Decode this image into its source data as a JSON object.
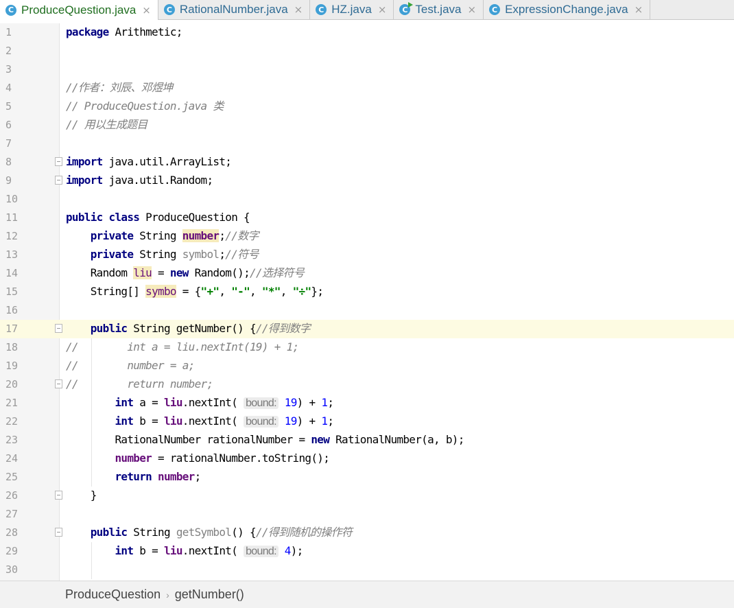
{
  "tabs": [
    {
      "label": "ProduceQuestion.java",
      "active": true,
      "icon": "class-icon"
    },
    {
      "label": "RationalNumber.java",
      "active": false,
      "icon": "class-icon"
    },
    {
      "label": "HZ.java",
      "active": false,
      "icon": "class-icon"
    },
    {
      "label": "Test.java",
      "active": false,
      "icon": "runnable-class-icon"
    },
    {
      "label": "ExpressionChange.java",
      "active": false,
      "icon": "class-icon"
    }
  ],
  "editor": {
    "current_line": 17,
    "lines": [
      {
        "n": "1",
        "segs": [
          [
            "k",
            "package"
          ],
          [
            "",
            "&nbsp;Arithmetic;"
          ]
        ]
      },
      {
        "n": "2",
        "segs": []
      },
      {
        "n": "3",
        "segs": []
      },
      {
        "n": "4",
        "segs": [
          [
            "c",
            "//作者：刘辰、邓煜坤"
          ]
        ]
      },
      {
        "n": "5",
        "segs": [
          [
            "c",
            "// ProduceQuestion.java 类"
          ]
        ]
      },
      {
        "n": "6",
        "segs": [
          [
            "c",
            "// 用以生成题目"
          ]
        ]
      },
      {
        "n": "7",
        "segs": []
      },
      {
        "n": "8",
        "fold": true,
        "segs": [
          [
            "k",
            "import"
          ],
          [
            "",
            "&nbsp;java.util.ArrayList;"
          ]
        ]
      },
      {
        "n": "9",
        "fold": true,
        "segs": [
          [
            "k",
            "import"
          ],
          [
            "",
            "&nbsp;java.util.Random;"
          ]
        ]
      },
      {
        "n": "10",
        "segs": []
      },
      {
        "n": "11",
        "segs": [
          [
            "k",
            "public class"
          ],
          [
            "",
            "&nbsp;ProduceQuestion {"
          ]
        ]
      },
      {
        "n": "12",
        "segs": [
          [
            "",
            "    "
          ],
          [
            "k",
            "private"
          ],
          [
            "",
            "&nbsp;String "
          ],
          [
            "fhl",
            "number"
          ],
          [
            "",
            ";"
          ],
          [
            "c",
            "//数字"
          ]
        ]
      },
      {
        "n": "13",
        "segs": [
          [
            "",
            "    "
          ],
          [
            "k",
            "private"
          ],
          [
            "",
            "&nbsp;String "
          ],
          [
            "u",
            "symbol"
          ],
          [
            "",
            ";"
          ],
          [
            "c",
            "//符号"
          ]
        ]
      },
      {
        "n": "14",
        "segs": [
          [
            "",
            "    Random "
          ],
          [
            "fh",
            "liu"
          ],
          [
            "",
            "&nbsp;= "
          ],
          [
            "k",
            "new"
          ],
          [
            "",
            "&nbsp;Random();"
          ],
          [
            "c",
            "//选择符号"
          ]
        ]
      },
      {
        "n": "15",
        "segs": [
          [
            "",
            "    String[] "
          ],
          [
            "fh",
            "symbo"
          ],
          [
            "",
            "&nbsp;= {"
          ],
          [
            "s",
            "\"+\""
          ],
          [
            "",
            ", "
          ],
          [
            "s",
            "\"-\""
          ],
          [
            "",
            ", "
          ],
          [
            "s",
            "\"*\""
          ],
          [
            "",
            ", "
          ],
          [
            "s",
            "\"÷\""
          ],
          [
            "",
            "};"
          ]
        ]
      },
      {
        "n": "16",
        "segs": []
      },
      {
        "n": "17",
        "fold": true,
        "segs": [
          [
            "",
            "    "
          ],
          [
            "k",
            "public"
          ],
          [
            "",
            "&nbsp;String getNumber() {"
          ],
          [
            "c",
            "//得到数字"
          ]
        ]
      },
      {
        "n": "18",
        "segs": [
          [
            "c",
            "//        int a = liu.nextInt(19) + 1;"
          ]
        ]
      },
      {
        "n": "19",
        "segs": [
          [
            "c",
            "//        number = a;"
          ]
        ]
      },
      {
        "n": "20",
        "fold": true,
        "segs": [
          [
            "c",
            "//        return number;"
          ]
        ]
      },
      {
        "n": "21",
        "segs": [
          [
            "",
            "        "
          ],
          [
            "k",
            "int"
          ],
          [
            "",
            "&nbsp;a = "
          ],
          [
            "f",
            "liu"
          ],
          [
            "",
            ".nextInt( "
          ],
          [
            "hint",
            "bound:"
          ],
          [
            "",
            "&nbsp;"
          ],
          [
            "n",
            "19"
          ],
          [
            "",
            ") + "
          ],
          [
            "n",
            "1"
          ],
          [
            "",
            ";"
          ]
        ]
      },
      {
        "n": "22",
        "segs": [
          [
            "",
            "        "
          ],
          [
            "k",
            "int"
          ],
          [
            "",
            "&nbsp;b = "
          ],
          [
            "f",
            "liu"
          ],
          [
            "",
            ".nextInt( "
          ],
          [
            "hint",
            "bound:"
          ],
          [
            "",
            "&nbsp;"
          ],
          [
            "n",
            "19"
          ],
          [
            "",
            ") + "
          ],
          [
            "n",
            "1"
          ],
          [
            "",
            ";"
          ]
        ]
      },
      {
        "n": "23",
        "segs": [
          [
            "",
            "        RationalNumber rationalNumber = "
          ],
          [
            "k",
            "new"
          ],
          [
            "",
            "&nbsp;RationalNumber(a, b);"
          ]
        ]
      },
      {
        "n": "24",
        "segs": [
          [
            "",
            "        "
          ],
          [
            "f",
            "number"
          ],
          [
            "",
            "&nbsp;= rationalNumber.toString();"
          ]
        ]
      },
      {
        "n": "25",
        "segs": [
          [
            "",
            "        "
          ],
          [
            "k",
            "return"
          ],
          [
            "",
            "&nbsp;"
          ],
          [
            "f",
            "number"
          ],
          [
            "",
            ";"
          ]
        ]
      },
      {
        "n": "26",
        "fold": true,
        "segs": [
          [
            "",
            "    }"
          ]
        ]
      },
      {
        "n": "27",
        "segs": []
      },
      {
        "n": "28",
        "fold": true,
        "segs": [
          [
            "",
            "    "
          ],
          [
            "k",
            "public"
          ],
          [
            "",
            "&nbsp;String "
          ],
          [
            "u",
            "getSymbol"
          ],
          [
            "",
            "() {"
          ],
          [
            "c",
            "//得到随机的操作符"
          ]
        ]
      },
      {
        "n": "29",
        "segs": [
          [
            "",
            "        "
          ],
          [
            "k",
            "int"
          ],
          [
            "",
            "&nbsp;b = "
          ],
          [
            "f",
            "liu"
          ],
          [
            "",
            ".nextInt( "
          ],
          [
            "hint",
            "bound:"
          ],
          [
            "",
            "&nbsp;"
          ],
          [
            "n",
            "4"
          ],
          [
            "",
            ");"
          ]
        ]
      },
      {
        "n": "30",
        "segs": []
      }
    ]
  },
  "breadcrumb": {
    "items": [
      "ProduceQuestion",
      "getNumber()"
    ],
    "separator": "›"
  }
}
